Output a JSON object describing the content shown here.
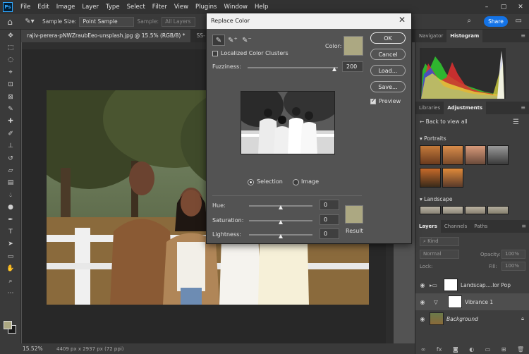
{
  "app": {
    "logo": "Ps"
  },
  "menu": [
    "File",
    "Edit",
    "Image",
    "Layer",
    "Type",
    "Select",
    "Filter",
    "View",
    "Plugins",
    "Window",
    "Help"
  ],
  "window_controls": {
    "minimize": "–",
    "maximize": "▢",
    "close": "✕"
  },
  "options": {
    "sample_size_label": "Sample Size:",
    "sample_size_value": "Point Sample",
    "sample_label": "Sample:",
    "sample_value": "All Layers",
    "share_label": "Share"
  },
  "tabs": [
    {
      "label": "rajiv-perera-pNWZraubEeo-unsplash.jpg @ 15.5% (RGB/8) *"
    },
    {
      "label": "SS- ps..."
    }
  ],
  "status": {
    "zoom": "15.52%",
    "doc_info": "4409 px x 2937 px (72 ppi)"
  },
  "panels": {
    "top_tabs": [
      "Navigator",
      "Histogram"
    ],
    "mid_tabs": [
      "Libraries",
      "Adjustments"
    ],
    "back_label": "Back to view all",
    "portraits_label": "Portraits",
    "landscape_label": "Landscape",
    "layer_tabs": [
      "Layers",
      "Channels",
      "Paths"
    ],
    "kind_placeholder": "Kind",
    "blend_mode": "Normal",
    "opacity_label": "Opacity:",
    "opacity_value": "100%",
    "lock_label": "Lock:",
    "fill_label": "Fill:",
    "fill_value": "100%",
    "layers": [
      {
        "name": "Landscap....lor Pop"
      },
      {
        "name": "Vibrance 1"
      },
      {
        "name": "Background"
      }
    ]
  },
  "dialog": {
    "title": "Replace Color",
    "localized_label": "Localized Color Clusters",
    "localized_checked": false,
    "color_label": "Color:",
    "fuzziness_label": "Fuzziness:",
    "fuzziness_value": "200",
    "selection_label": "Selection",
    "image_label": "Image",
    "view_mode": "Selection",
    "hue_label": "Hue:",
    "hue_value": "0",
    "saturation_label": "Saturation:",
    "saturation_value": "0",
    "lightness_label": "Lightness:",
    "lightness_value": "0",
    "result_label": "Result",
    "ok_label": "OK",
    "cancel_label": "Cancel",
    "load_label": "Load...",
    "save_label": "Save...",
    "preview_label": "Preview",
    "preview_checked": true,
    "swatch_color": "#aca882"
  }
}
